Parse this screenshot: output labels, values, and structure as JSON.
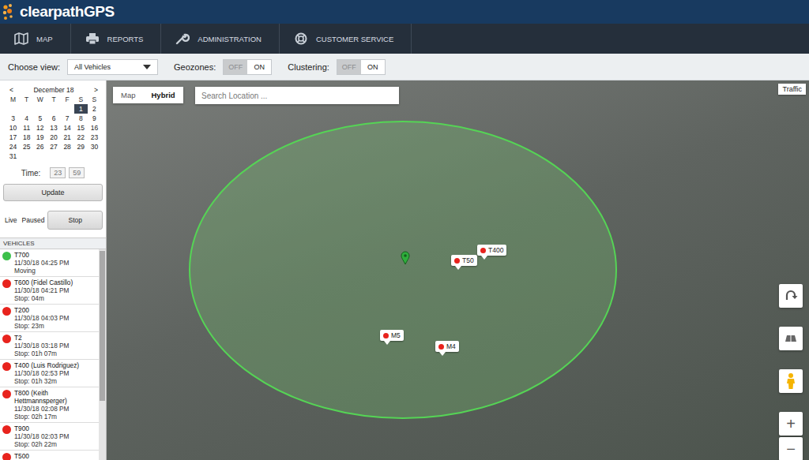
{
  "header": {
    "logo": "clearpathGPS"
  },
  "nav": [
    {
      "label": "MAP"
    },
    {
      "label": "REPORTS"
    },
    {
      "label": "ADMINISTRATION"
    },
    {
      "label": "CUSTOMER SERVICE"
    }
  ],
  "toolbar": {
    "view_label": "Choose view:",
    "view_value": "All Vehicles",
    "geozones": {
      "label": "Geozones:",
      "options": [
        {
          "label": "OFF",
          "selected": false
        },
        {
          "label": "ON",
          "selected": true
        }
      ]
    },
    "clustering": {
      "label": "Clustering:",
      "options": [
        {
          "label": "OFF",
          "selected": false
        },
        {
          "label": "ON",
          "selected": true
        }
      ]
    }
  },
  "calendar": {
    "prev": "<",
    "month": "December 18",
    "next": ">",
    "weekdays": [
      "M",
      "T",
      "W",
      "T",
      "F",
      "S",
      "S"
    ],
    "weeks": [
      [
        {
          "day": "",
          "selected": false
        },
        {
          "day": "",
          "selected": false
        },
        {
          "day": "",
          "selected": false
        },
        {
          "day": "",
          "selected": false
        },
        {
          "day": "",
          "selected": false
        },
        {
          "day": "1",
          "selected": true
        },
        {
          "day": "2",
          "selected": false
        }
      ],
      [
        {
          "day": "3",
          "selected": false
        },
        {
          "day": "4",
          "selected": false
        },
        {
          "day": "5",
          "selected": false
        },
        {
          "day": "6",
          "selected": false
        },
        {
          "day": "7",
          "selected": false
        },
        {
          "day": "8",
          "selected": false
        },
        {
          "day": "9",
          "selected": false
        }
      ],
      [
        {
          "day": "10",
          "selected": false
        },
        {
          "day": "11",
          "selected": false
        },
        {
          "day": "12",
          "selected": false
        },
        {
          "day": "13",
          "selected": false
        },
        {
          "day": "14",
          "selected": false
        },
        {
          "day": "15",
          "selected": false
        },
        {
          "day": "16",
          "selected": false
        }
      ],
      [
        {
          "day": "17",
          "selected": false
        },
        {
          "day": "18",
          "selected": false
        },
        {
          "day": "19",
          "selected": false
        },
        {
          "day": "20",
          "selected": false
        },
        {
          "day": "21",
          "selected": false
        },
        {
          "day": "22",
          "selected": false
        },
        {
          "day": "23",
          "selected": false
        }
      ],
      [
        {
          "day": "24",
          "selected": false
        },
        {
          "day": "25",
          "selected": false
        },
        {
          "day": "26",
          "selected": false
        },
        {
          "day": "27",
          "selected": false
        },
        {
          "day": "28",
          "selected": false
        },
        {
          "day": "29",
          "selected": false
        },
        {
          "day": "30",
          "selected": false
        }
      ],
      [
        {
          "day": "31",
          "selected": false
        }
      ]
    ]
  },
  "time": {
    "label": "Time:",
    "hour": "23",
    "minute": "59"
  },
  "update_button": "Update",
  "playback": [
    {
      "label": "Live",
      "selected": false
    },
    {
      "label": "Paused",
      "selected": false
    },
    {
      "label": "Stop",
      "selected": true
    }
  ],
  "vehicles": {
    "title": "VEHICLES",
    "items": [
      {
        "name": "T700",
        "date": "11/30/18 04:25 PM",
        "status": "Moving",
        "color": "#3cc04a"
      },
      {
        "name": "T600 (Fidel Castillo)",
        "date": "11/30/18 04:21 PM",
        "status": "Stop: 04m",
        "color": "#e8231d"
      },
      {
        "name": "T200",
        "date": "11/30/18 04:03 PM",
        "status": "Stop: 23m",
        "color": "#e8231d"
      },
      {
        "name": "T2",
        "date": "11/30/18 03:18 PM",
        "status": "Stop: 01h 07m",
        "color": "#e8231d"
      },
      {
        "name": "T400 (Luis Rodriguez)",
        "date": "11/30/18 02:53 PM",
        "status": "Stop: 01h 32m",
        "color": "#e8231d"
      },
      {
        "name": "T800 (Keith Hettmannsperger)",
        "date": "11/30/18 02:08 PM",
        "status": "Stop: 02h 17m",
        "color": "#e8231d"
      },
      {
        "name": "T900",
        "date": "11/30/18 02:03 PM",
        "status": "Stop: 02h 22m",
        "color": "#e8231d"
      },
      {
        "name": "T500",
        "color": "#e8231d"
      }
    ]
  },
  "map": {
    "tabs": [
      {
        "label": "Map",
        "selected": false
      },
      {
        "label": "Hybrid",
        "selected": true
      }
    ],
    "search": {
      "placeholder": "Search Location ..."
    },
    "traffic": "Traffic",
    "markers": [
      {
        "label": "T50",
        "color": "#e8231d"
      },
      {
        "label": "T400",
        "color": "#e8231d"
      },
      {
        "label": "M5",
        "color": "#e8231d"
      },
      {
        "label": "M4",
        "color": "#e8231d"
      }
    ],
    "zoom_in": "+",
    "zoom_out": "−"
  }
}
